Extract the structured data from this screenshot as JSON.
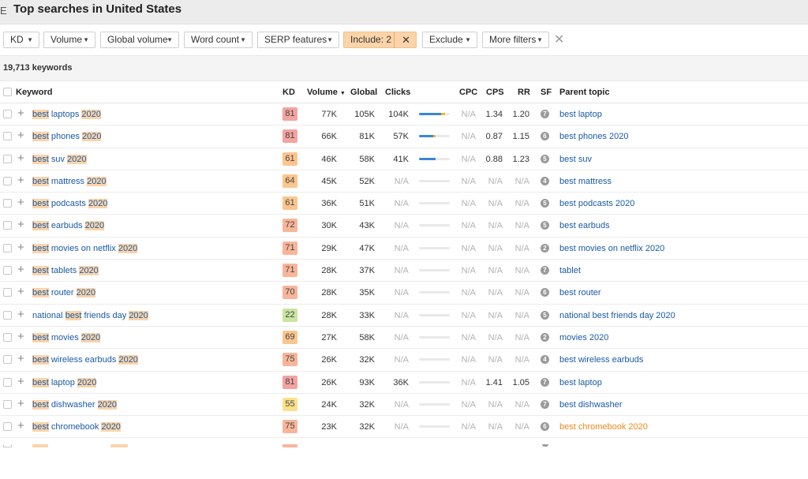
{
  "header": {
    "title": "Top searches in United States",
    "edge_glyph": "E"
  },
  "filters": {
    "buttons": [
      "KD",
      "Volume",
      "Global volume",
      "Word count",
      "SERP features"
    ],
    "include_label": "Include: 2",
    "exclude_label": "Exclude",
    "more_label": "More filters"
  },
  "summary": {
    "keyword_count": "19,713 keywords"
  },
  "columns": {
    "keyword": "Keyword",
    "kd": "KD",
    "volume": "Volume",
    "global": "Global",
    "clicks": "Clicks",
    "cpc": "CPC",
    "cps": "CPS",
    "rr": "RR",
    "sf": "SF",
    "parent": "Parent topic"
  },
  "colors": {
    "link": "#1a5aa6",
    "highlight": "#fbd4a9",
    "kd_red": "#f4a3a0",
    "kd_orange": "#fcc58e",
    "kd_yellow": "#fde08a",
    "kd_green": "#c9e5a0",
    "clicks_organic": "#3a86d8",
    "clicks_paid": "#f0b62b"
  },
  "rows": [
    {
      "pre": "",
      "hl": "best",
      "mid": " laptops ",
      "yr": "2020",
      "post": "",
      "kd": "81",
      "kd_color": "#f4a3a0",
      "volume": "77K",
      "global": "105K",
      "clicks": "104K",
      "click_organic": 0.72,
      "click_paid": 0.12,
      "cpc": "N/A",
      "cps": "1.34",
      "rr": "1.20",
      "sf": "7",
      "parent": "best laptop",
      "parent_orange": false
    },
    {
      "pre": "",
      "hl": "best",
      "mid": " phones ",
      "yr": "2020",
      "post": "",
      "kd": "81",
      "kd_color": "#f4a3a0",
      "volume": "66K",
      "global": "81K",
      "clicks": "57K",
      "click_organic": 0.45,
      "click_paid": 0.1,
      "cpc": "N/A",
      "cps": "0.87",
      "rr": "1.15",
      "sf": "6",
      "parent": "best phones 2020",
      "parent_orange": false
    },
    {
      "pre": "",
      "hl": "best",
      "mid": " suv ",
      "yr": "2020",
      "post": "",
      "kd": "61",
      "kd_color": "#fcc58e",
      "volume": "46K",
      "global": "58K",
      "clicks": "41K",
      "click_organic": 0.55,
      "click_paid": 0.0,
      "cpc": "N/A",
      "cps": "0.88",
      "rr": "1.23",
      "sf": "5",
      "parent": "best suv",
      "parent_orange": false
    },
    {
      "pre": "",
      "hl": "best",
      "mid": " mattress ",
      "yr": "2020",
      "post": "",
      "kd": "64",
      "kd_color": "#fcc58e",
      "volume": "45K",
      "global": "52K",
      "clicks": "N/A",
      "click_organic": 0,
      "click_paid": 0,
      "cpc": "N/A",
      "cps": "N/A",
      "rr": "N/A",
      "sf": "4",
      "parent": "best mattress",
      "parent_orange": false
    },
    {
      "pre": "",
      "hl": "best",
      "mid": " podcasts ",
      "yr": "2020",
      "post": "",
      "kd": "61",
      "kd_color": "#fcc58e",
      "volume": "36K",
      "global": "51K",
      "clicks": "N/A",
      "click_organic": 0,
      "click_paid": 0,
      "cpc": "N/A",
      "cps": "N/A",
      "rr": "N/A",
      "sf": "5",
      "parent": "best podcasts 2020",
      "parent_orange": false
    },
    {
      "pre": "",
      "hl": "best",
      "mid": " earbuds ",
      "yr": "2020",
      "post": "",
      "kd": "72",
      "kd_color": "#f8b59a",
      "volume": "30K",
      "global": "43K",
      "clicks": "N/A",
      "click_organic": 0,
      "click_paid": 0,
      "cpc": "N/A",
      "cps": "N/A",
      "rr": "N/A",
      "sf": "5",
      "parent": "best earbuds",
      "parent_orange": false
    },
    {
      "pre": "",
      "hl": "best",
      "mid": " movies on netflix ",
      "yr": "2020",
      "post": "",
      "kd": "71",
      "kd_color": "#f8b59a",
      "volume": "29K",
      "global": "47K",
      "clicks": "N/A",
      "click_organic": 0,
      "click_paid": 0,
      "cpc": "N/A",
      "cps": "N/A",
      "rr": "N/A",
      "sf": "2",
      "parent": "best movies on netflix 2020",
      "parent_orange": false
    },
    {
      "pre": "",
      "hl": "best",
      "mid": " tablets ",
      "yr": "2020",
      "post": "",
      "kd": "71",
      "kd_color": "#f8b59a",
      "volume": "28K",
      "global": "37K",
      "clicks": "N/A",
      "click_organic": 0,
      "click_paid": 0,
      "cpc": "N/A",
      "cps": "N/A",
      "rr": "N/A",
      "sf": "7",
      "parent": "tablet",
      "parent_orange": false
    },
    {
      "pre": "",
      "hl": "best",
      "mid": " router ",
      "yr": "2020",
      "post": "",
      "kd": "70",
      "kd_color": "#f8b59a",
      "volume": "28K",
      "global": "35K",
      "clicks": "N/A",
      "click_organic": 0,
      "click_paid": 0,
      "cpc": "N/A",
      "cps": "N/A",
      "rr": "N/A",
      "sf": "6",
      "parent": "best router",
      "parent_orange": false
    },
    {
      "pre": "national ",
      "hl": "best",
      "mid": " friends day ",
      "yr": "2020",
      "post": "",
      "kd": "22",
      "kd_color": "#c9e5a0",
      "volume": "28K",
      "global": "33K",
      "clicks": "N/A",
      "click_organic": 0,
      "click_paid": 0,
      "cpc": "N/A",
      "cps": "N/A",
      "rr": "N/A",
      "sf": "5",
      "parent": "national best friends day 2020",
      "parent_orange": false
    },
    {
      "pre": "",
      "hl": "best",
      "mid": " movies ",
      "yr": "2020",
      "post": "",
      "kd": "69",
      "kd_color": "#fcc58e",
      "volume": "27K",
      "global": "58K",
      "clicks": "N/A",
      "click_organic": 0,
      "click_paid": 0,
      "cpc": "N/A",
      "cps": "N/A",
      "rr": "N/A",
      "sf": "2",
      "parent": "movies 2020",
      "parent_orange": false
    },
    {
      "pre": "",
      "hl": "best",
      "mid": " wireless earbuds ",
      "yr": "2020",
      "post": "",
      "kd": "75",
      "kd_color": "#f8b59a",
      "volume": "26K",
      "global": "32K",
      "clicks": "N/A",
      "click_organic": 0,
      "click_paid": 0,
      "cpc": "N/A",
      "cps": "N/A",
      "rr": "N/A",
      "sf": "4",
      "parent": "best wireless earbuds",
      "parent_orange": false
    },
    {
      "pre": "",
      "hl": "best",
      "mid": " laptop ",
      "yr": "2020",
      "post": "",
      "kd": "81",
      "kd_color": "#f4a3a0",
      "volume": "26K",
      "global": "93K",
      "clicks": "36K",
      "click_organic": 0.0,
      "click_paid": 0.0,
      "cpc": "N/A",
      "cps": "1.41",
      "rr": "1.05",
      "sf": "7",
      "parent": "best laptop",
      "parent_orange": false
    },
    {
      "pre": "",
      "hl": "best",
      "mid": " dishwasher ",
      "yr": "2020",
      "post": "",
      "kd": "55",
      "kd_color": "#fde08a",
      "volume": "24K",
      "global": "32K",
      "clicks": "N/A",
      "click_organic": 0,
      "click_paid": 0,
      "cpc": "N/A",
      "cps": "N/A",
      "rr": "N/A",
      "sf": "7",
      "parent": "best dishwasher",
      "parent_orange": false
    },
    {
      "pre": "",
      "hl": "best",
      "mid": " chromebook ",
      "yr": "2020",
      "post": "",
      "kd": "75",
      "kd_color": "#f8b59a",
      "volume": "23K",
      "global": "32K",
      "clicks": "N/A",
      "click_organic": 0,
      "click_paid": 0,
      "cpc": "N/A",
      "cps": "N/A",
      "rr": "N/A",
      "sf": "6",
      "parent": "best chromebook 2020",
      "parent_orange": true
    }
  ]
}
